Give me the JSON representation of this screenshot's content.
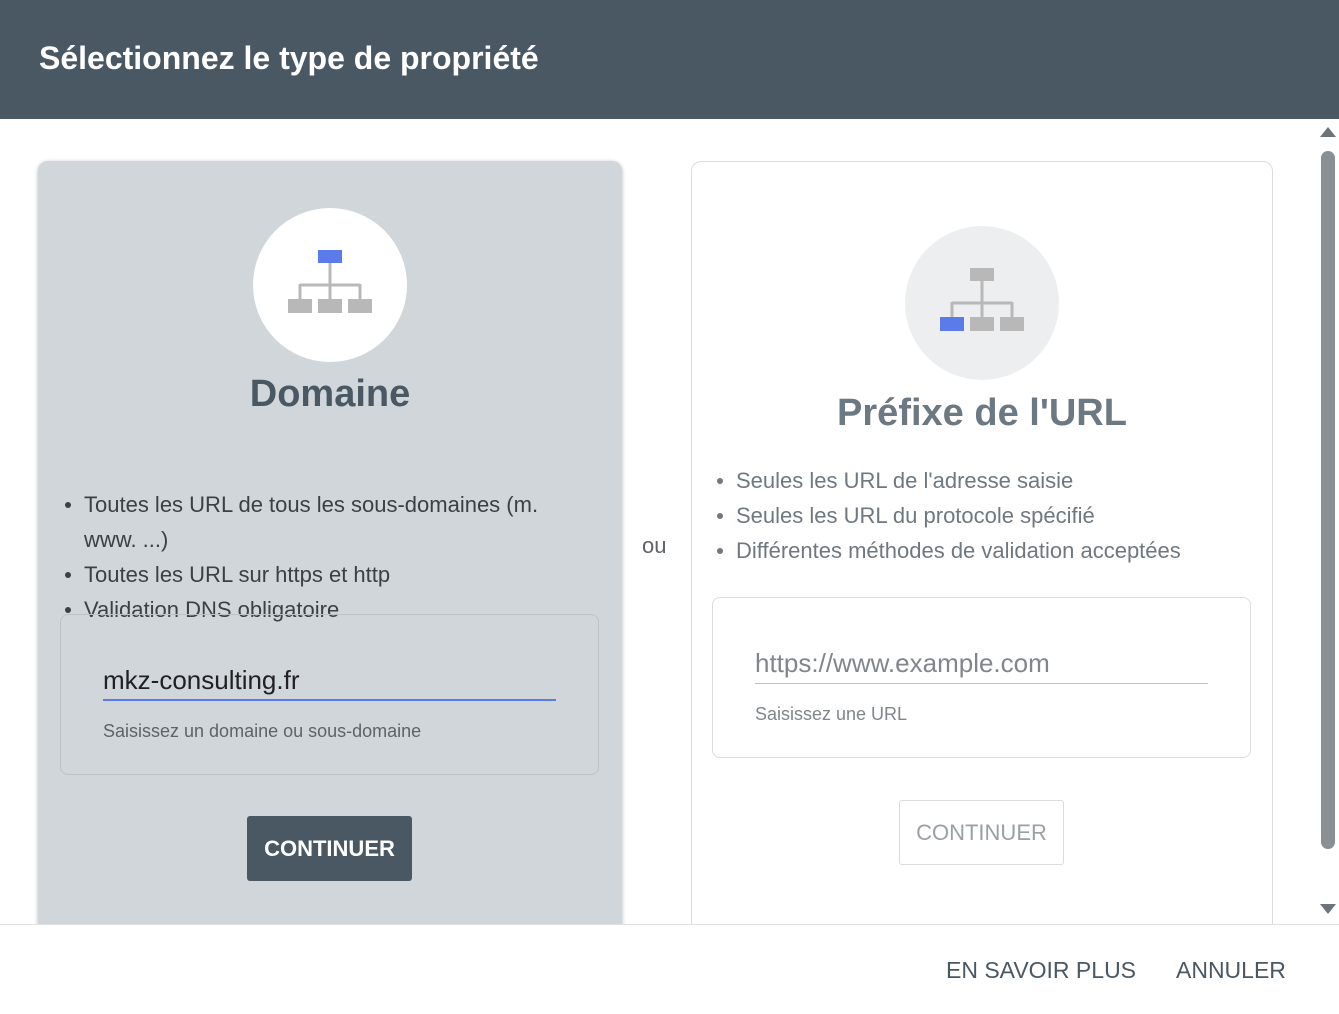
{
  "header": {
    "title": "Sélectionnez le type de propriété"
  },
  "domain_card": {
    "icon": "sitemap-icon",
    "title": "Domaine",
    "bullets": [
      "Toutes les URL de tous les sous-domaines (m. www. ...)",
      "Toutes les URL sur https et http",
      "Validation DNS obligatoire"
    ],
    "input_value": "mkz-consulting.fr",
    "hint": "Saisissez un domaine ou sous-domaine",
    "continue_label": "CONTINUER"
  },
  "separator": "ou",
  "url_card": {
    "icon": "sitemap-icon",
    "title": "Préfixe de l'URL",
    "bullets": [
      "Seules les URL de l'adresse saisie",
      "Seules les URL du protocole spécifié",
      "Différentes méthodes de validation acceptées"
    ],
    "input_value": "",
    "input_placeholder": "https://www.example.com",
    "hint": "Saisissez une URL",
    "continue_label": "CONTINUER"
  },
  "footer": {
    "learn_more_label": "EN SAVOIR PLUS",
    "cancel_label": "ANNULER"
  },
  "colors": {
    "header_bg": "#4a5864",
    "selected_card_bg": "#d1d6db",
    "accent_blue": "#5b7bea",
    "icon_gray": "#b8b8b8"
  }
}
